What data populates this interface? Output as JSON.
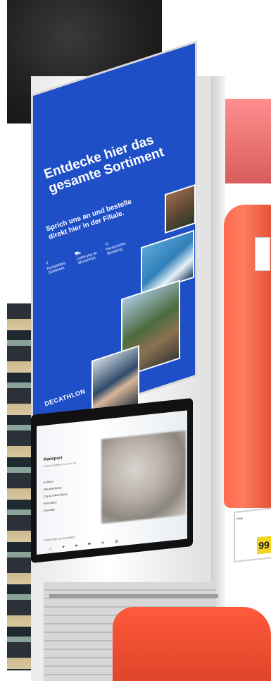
{
  "poster": {
    "headline": "Entdecke hier das gesamte Sortiment",
    "subline": "Sprich uns an und bestelle direkt hier in der Filiale.",
    "features": [
      {
        "icon": "check-icon",
        "label": "Komplettes Sortiment"
      },
      {
        "icon": "truck-icon",
        "label": "Lieferung an Wunschort"
      },
      {
        "icon": "people-icon",
        "label": "Persönliche Beratung"
      }
    ],
    "brand": "DECATHLON",
    "photos": [
      "cycling-photo",
      "swimming-photo",
      "hiking-photo",
      "portrait-photo"
    ]
  },
  "kiosk": {
    "title": "Radsport",
    "subtitle": "Unsere Sortiment hier vor Ort",
    "menu": [
      "E-Bikes",
      "Mountainbikes",
      "City & Urban Bikes",
      "Rennräder",
      "Dreiräder"
    ],
    "footer": "Direkt über uns bestellen"
  },
  "price_tag": {
    "label": "Preis",
    "value": "99"
  },
  "colors": {
    "poster_blue": "#1f4fc7",
    "jacket_red": "#ff6a4e",
    "price_yellow": "#f4d321"
  }
}
